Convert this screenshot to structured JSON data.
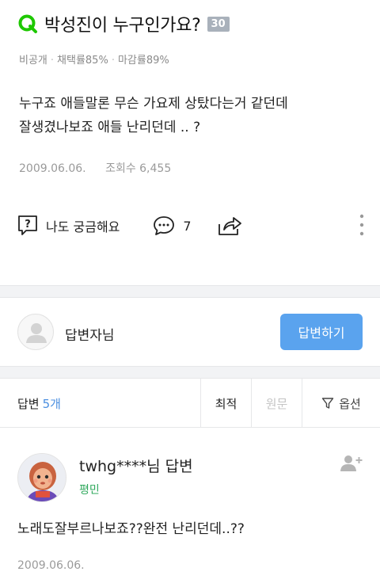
{
  "question": {
    "title": "박성진이 누구인가요?",
    "badge": "30",
    "meta": {
      "visibility": "비공개",
      "adoption_rate": "채택률85%",
      "closing_rate": "마감률89%"
    },
    "body_lines": [
      "누구죠 애들말론 무슨 가요제 상탔다는거 같던데",
      "잘생겼나보죠 애들 난리던데 .. ?"
    ],
    "date": "2009.06.06.",
    "views": "조회수 6,455",
    "actions": {
      "curious_label": "나도 궁금해요",
      "comment_count": "7"
    }
  },
  "answer_prompt": {
    "label": "답변자님",
    "button_label": "답변하기"
  },
  "sort_bar": {
    "count_label": "답변",
    "count_value": "5개",
    "tabs": {
      "latest": "최적",
      "original": "원문",
      "options": "옵션"
    }
  },
  "answer": {
    "author": "twhg****님 답변",
    "rank": "평민",
    "body": "노래도잘부르나보죠??완전 난리던데..??",
    "date": "2009.06.06."
  },
  "colors": {
    "brand_green": "#1ec800",
    "button_blue": "#5aa3ee",
    "rank_green": "#2fa85c",
    "count_blue": "#4b8fe0"
  }
}
